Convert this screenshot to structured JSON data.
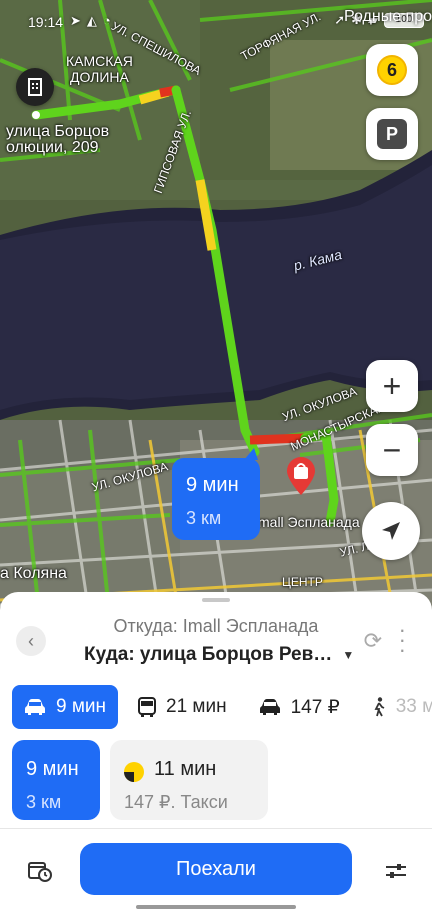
{
  "status_bar": {
    "time": "19:14",
    "left_icons": [
      "telegram-icon",
      "nav-icon",
      "wifi-icon"
    ],
    "battery": "100",
    "home_link": "Родные про"
  },
  "map": {
    "labels": {
      "district": "КАМСКАЯ\nДОЛИНА",
      "street_speshilova": "УЛ. СПЕШИЛОВА",
      "street_tornaya": "ТОРФЯНАЯ УЛ.",
      "street_gipsovaya": "ГИПСОВАЯ УЛ.",
      "address": "улица Борцов\nолюции, 209",
      "river": "р. Кама",
      "street_okulova_right": "УЛ. ОКУЛОВА",
      "street_monastyrskaya": "МОНАСТЫРСКАЯ УЛ.",
      "street_okulova_left": "УЛ. ОКУЛОВА",
      "mall": "mall Эспланада",
      "street_lenina": "УЛ. ЛЕН",
      "center": "ЦЕНТР",
      "kolyana": "а Коляна"
    },
    "traffic_level": "6",
    "parking_label": "P",
    "zoom_in_label": "+",
    "zoom_out_label": "−",
    "route_bubble": {
      "time": "9 мин",
      "distance": "3 км"
    }
  },
  "sheet": {
    "from_label": "Откуда: Imall Эспланада",
    "to_label": "Куда: улица Борцов Рев…",
    "modes": [
      {
        "icon": "car-icon",
        "label": "9 мин"
      },
      {
        "icon": "bus-icon",
        "label": "21 мин"
      },
      {
        "icon": "taxi-icon",
        "label": "147 ₽"
      },
      {
        "icon": "walk-icon",
        "label": "33 м"
      }
    ],
    "cards": {
      "route": {
        "time": "9 мин",
        "distance": "3 км"
      },
      "taxi": {
        "time": "11 мин",
        "price": "147 ₽. Такси"
      }
    },
    "go_button": "Поехали"
  },
  "colors": {
    "accent": "#1f6cf5",
    "route_green": "#5fd41c",
    "route_yellow": "#f5d21f",
    "route_red": "#e0321e",
    "traffic_yellow": "#ffd200"
  }
}
